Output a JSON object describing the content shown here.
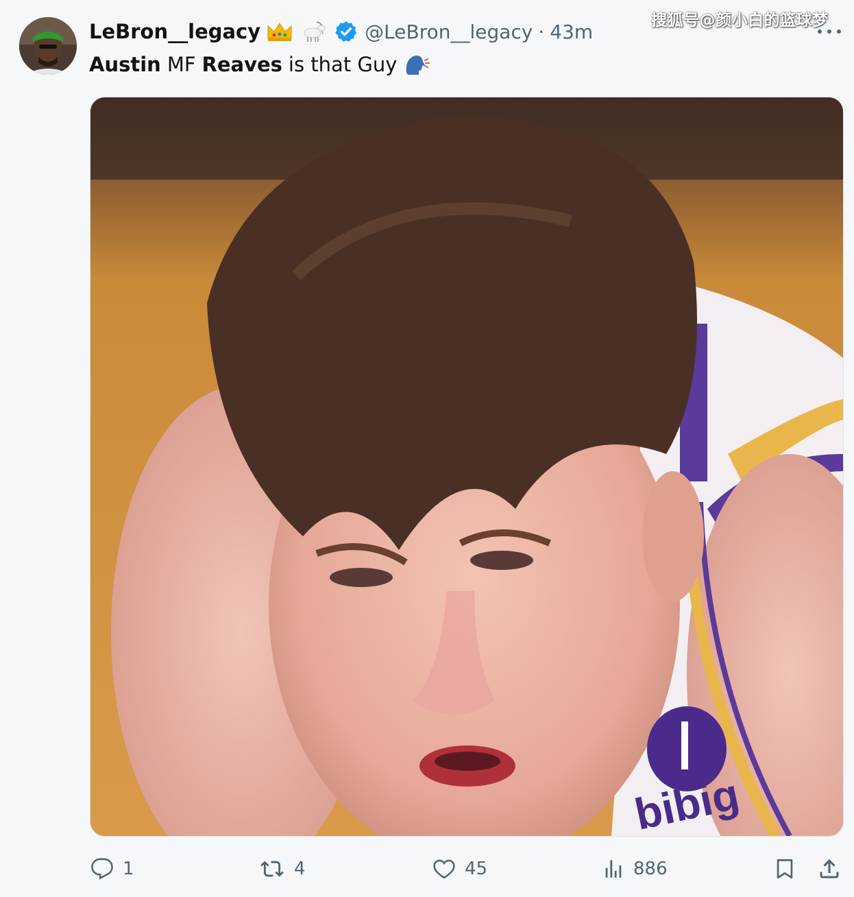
{
  "tweet": {
    "author": {
      "display_name": "LeBron__legacy",
      "handle": "@LeBron__legacy",
      "emoji_badges": [
        "crown-emoji",
        "goat-emoji"
      ],
      "verified": true
    },
    "time_ago": "43m",
    "separator": "·",
    "text": {
      "part1": "Austin",
      "part2": "MF",
      "part3": "Reaves",
      "part4": "is that Guy",
      "trailing_emoji": "speaking-head-emoji"
    },
    "media": {
      "icon": "photo-media",
      "jersey_text": "bibig"
    },
    "actions": {
      "reply_count": "1",
      "retweet_count": "4",
      "like_count": "45",
      "view_count": "886"
    }
  },
  "watermark": "搜狐号@颜小白的篮球梦",
  "colors": {
    "text_primary": "#0f1419",
    "text_secondary": "#536471",
    "verified_blue": "#1d9bf0",
    "background": "#f5f7f9"
  }
}
